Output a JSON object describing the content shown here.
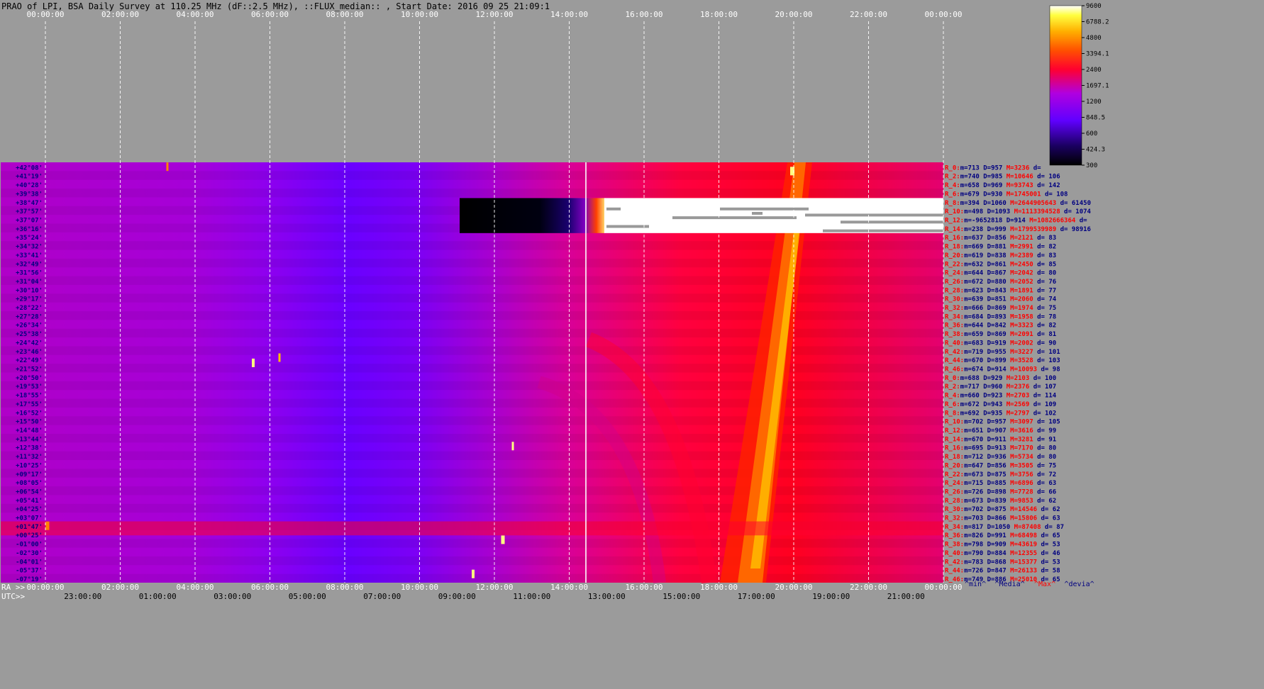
{
  "title": "PRAO of LPI, BSA Daily Survey at 110.25 MHz (dF::2.5 MHz), ::FLUX_median:: , Start Date: 2016 09 25 21:09:1",
  "colors": {
    "background": "#9b9b9b",
    "label_red": "#ff0000",
    "label_navy": "#000080",
    "grid": "#ffffff"
  },
  "chart_data": {
    "type": "heatmap",
    "title": "PRAO of LPI, BSA Daily Survey at 110.25 MHz (dF::2.5 MHz), ::FLUX_median:: , Start Date: 2016 09 25 21:09:1",
    "top_axis_ticks": [
      "00:00:00",
      "02:00:00",
      "04:00:00",
      "06:00:00",
      "08:00:00",
      "10:00:00",
      "12:00:00",
      "14:00:00",
      "16:00:00",
      "18:00:00",
      "20:00:00",
      "22:00:00",
      "00:00:00"
    ],
    "bottom_axis_label_ra": "RA >>",
    "bottom_axis_label_utc": "UTC>>",
    "bottom_ra_ticks": [
      "00:00:00",
      "02:00:00",
      "04:00:00",
      "06:00:00",
      "08:00:00",
      "10:00:00",
      "12:00:00",
      "14:00:00",
      "16:00:00",
      "18:00:00",
      "20:00:00",
      "22:00:00",
      "00:00:00"
    ],
    "bottom_utc_ticks": [
      "23:00:00",
      "01:00:00",
      "03:00:00",
      "05:00:00",
      "07:00:00",
      "09:00:00",
      "11:00:00",
      "13:00:00",
      "15:00:00",
      "17:00:00",
      "19:00:00",
      "21:00:00"
    ],
    "declination_labels": [
      "+42°08'",
      "+41°19'",
      "+40°28'",
      "+39°38'",
      "+38°47'",
      "+37°57'",
      "+37°07'",
      "+36°16'",
      "+35°24'",
      "+34°32'",
      "+33°41'",
      "+32°49'",
      "+31°56'",
      "+31°04'",
      "+30°10'",
      "+29°17'",
      "+28°22'",
      "+27°28'",
      "+26°34'",
      "+25°38'",
      "+24°42'",
      "+23°46'",
      "+22°49'",
      "+21°52'",
      "+20°50'",
      "+19°53'",
      "+18°55'",
      "+17°55'",
      "+16°52'",
      "+15°50'",
      "+14°48'",
      "+13°44'",
      "+12°38'",
      "+11°32'",
      "+10°25'",
      "+09°17'",
      "+08°05'",
      "+06°54'",
      "+05°41'",
      "+04°25'",
      "+03°07'",
      "+01°47'",
      "+00°25'",
      "-01°00'",
      "-02°30'",
      "-04°01'",
      "-05°37'",
      "-07°19'"
    ],
    "colorbar_ticks": [
      9600.0,
      6788.2,
      4800.0,
      3394.1,
      2400.0,
      1697.1,
      1200.0,
      848.5,
      600.0,
      424.3,
      300.0
    ],
    "colorbar_scale": "log",
    "colorbar_range": [
      300,
      9600
    ],
    "stats_rows": [
      {
        "tag": "R_0:",
        "m": "713",
        "D": "957",
        "M": "3236",
        "d": ""
      },
      {
        "tag": "R_2:",
        "m": "740",
        "D": "985",
        "M": "10646",
        "d": "106"
      },
      {
        "tag": "R_4:",
        "m": "658",
        "D": "969",
        "M": "93743",
        "d": "142"
      },
      {
        "tag": "R_6:",
        "m": "679",
        "D": "930",
        "M": "1745001",
        "d": "108"
      },
      {
        "tag": "R_8:",
        "m": "394",
        "D": "1060",
        "M": "2644905643",
        "d": "61450"
      },
      {
        "tag": "R_10:",
        "m": "498",
        "D": "1093",
        "M": "1113394528",
        "d": "1074"
      },
      {
        "tag": "R_12:",
        "m": "-9652818",
        "D": "914",
        "M": "1082666364",
        "d": ""
      },
      {
        "tag": "R_14:",
        "m": "238",
        "D": "999",
        "M": "1799539989",
        "d": "98916"
      },
      {
        "tag": "R_16:",
        "m": "637",
        "D": "856",
        "M": "2121",
        "d": "83"
      },
      {
        "tag": "R_18:",
        "m": "669",
        "D": "881",
        "M": "2991",
        "d": "82"
      },
      {
        "tag": "R_20:",
        "m": "619",
        "D": "838",
        "M": "2389",
        "d": "83"
      },
      {
        "tag": "R_22:",
        "m": "632",
        "D": "861",
        "M": "2450",
        "d": "85"
      },
      {
        "tag": "R_24:",
        "m": "644",
        "D": "867",
        "M": "2042",
        "d": "80"
      },
      {
        "tag": "R_26:",
        "m": "672",
        "D": "880",
        "M": "2052",
        "d": "76"
      },
      {
        "tag": "R_28:",
        "m": "623",
        "D": "843",
        "M": "1891",
        "d": "77"
      },
      {
        "tag": "R_30:",
        "m": "639",
        "D": "851",
        "M": "2060",
        "d": "74"
      },
      {
        "tag": "R_32:",
        "m": "666",
        "D": "869",
        "M": "1974",
        "d": "75"
      },
      {
        "tag": "R_34:",
        "m": "684",
        "D": "893",
        "M": "1958",
        "d": "78"
      },
      {
        "tag": "R_36:",
        "m": "644",
        "D": "842",
        "M": "3323",
        "d": "82"
      },
      {
        "tag": "R_38:",
        "m": "659",
        "D": "869",
        "M": "2091",
        "d": "81"
      },
      {
        "tag": "R_40:",
        "m": "683",
        "D": "919",
        "M": "2002",
        "d": "90"
      },
      {
        "tag": "R_42:",
        "m": "719",
        "D": "955",
        "M": "3227",
        "d": "101"
      },
      {
        "tag": "R_44:",
        "m": "670",
        "D": "899",
        "M": "3528",
        "d": "103"
      },
      {
        "tag": "R_46:",
        "m": "674",
        "D": "914",
        "M": "10093",
        "d": "98"
      },
      {
        "tag": "R_0:",
        "m": "688",
        "D": "929",
        "M": "2103",
        "d": "100"
      },
      {
        "tag": "R_2:",
        "m": "717",
        "D": "960",
        "M": "2376",
        "d": "107"
      },
      {
        "tag": "R_4:",
        "m": "660",
        "D": "923",
        "M": "2703",
        "d": "114"
      },
      {
        "tag": "R_6:",
        "m": "672",
        "D": "943",
        "M": "2569",
        "d": "109"
      },
      {
        "tag": "R_8:",
        "m": "692",
        "D": "935",
        "M": "2797",
        "d": "102"
      },
      {
        "tag": "R_10:",
        "m": "702",
        "D": "957",
        "M": "3097",
        "d": "105"
      },
      {
        "tag": "R_12:",
        "m": "651",
        "D": "907",
        "M": "3616",
        "d": "99"
      },
      {
        "tag": "R_14:",
        "m": "670",
        "D": "911",
        "M": "3281",
        "d": "91"
      },
      {
        "tag": "R_16:",
        "m": "695",
        "D": "913",
        "M": "7170",
        "d": "80"
      },
      {
        "tag": "R_18:",
        "m": "712",
        "D": "936",
        "M": "5734",
        "d": "80"
      },
      {
        "tag": "R_20:",
        "m": "647",
        "D": "856",
        "M": "3505",
        "d": "75"
      },
      {
        "tag": "R_22:",
        "m": "673",
        "D": "875",
        "M": "3756",
        "d": "72"
      },
      {
        "tag": "R_24:",
        "m": "715",
        "D": "885",
        "M": "6896",
        "d": "63"
      },
      {
        "tag": "R_26:",
        "m": "726",
        "D": "898",
        "M": "7728",
        "d": "66"
      },
      {
        "tag": "R_28:",
        "m": "673",
        "D": "839",
        "M": "9853",
        "d": "62"
      },
      {
        "tag": "R_30:",
        "m": "702",
        "D": "875",
        "M": "14546",
        "d": "62"
      },
      {
        "tag": "R_32:",
        "m": "703",
        "D": "866",
        "M": "15806",
        "d": "63"
      },
      {
        "tag": "R_34:",
        "m": "817",
        "D": "1050",
        "M": "87408",
        "d": "87"
      },
      {
        "tag": "R_36:",
        "m": "826",
        "D": "991",
        "M": "68498",
        "d": "65"
      },
      {
        "tag": "R_38:",
        "m": "798",
        "D": "909",
        "M": "43619",
        "d": "53"
      },
      {
        "tag": "R_40:",
        "m": "790",
        "D": "884",
        "M": "12355",
        "d": "46"
      },
      {
        "tag": "R_42:",
        "m": "783",
        "D": "868",
        "M": "15377",
        "d": "53"
      },
      {
        "tag": "R_44:",
        "m": "726",
        "D": "847",
        "M": "26133",
        "d": "58"
      },
      {
        "tag": "R_46:",
        "m": "749",
        "D": "886",
        "M": "25010",
        "d": "65"
      }
    ],
    "stats_footer": [
      {
        "text": "^min^",
        "color": "navy"
      },
      {
        "text": "^Media^",
        "color": "navy"
      },
      {
        "text": "^Max^",
        "color": "red"
      },
      {
        "text": "^devia^",
        "color": "navy"
      }
    ]
  }
}
